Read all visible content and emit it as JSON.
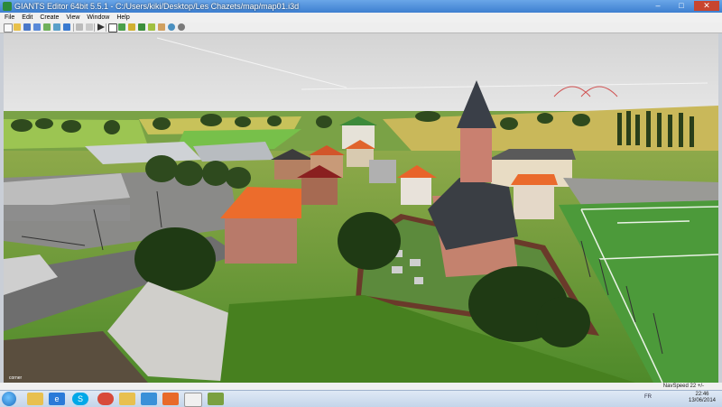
{
  "window": {
    "title": "GIANTS Editor 64bit 5.5.1 - C:/Users/kiki/Desktop/Les Chazets/map/map01.i3d",
    "minimize": "–",
    "maximize": "□",
    "close": "✕"
  },
  "menu": {
    "items": [
      "File",
      "Edit",
      "Create",
      "View",
      "Window",
      "Help"
    ]
  },
  "toolbar": {
    "icons": [
      "new-icon",
      "open-icon",
      "save-icon",
      "save-as-icon",
      "import-icon",
      "export-icon",
      "undo-icon",
      "redo-icon",
      "cut-icon",
      "copy-icon",
      "paste-icon",
      "play-icon",
      "select-icon",
      "move-icon",
      "rotate-icon",
      "scale-icon",
      "terrain-icon",
      "paint-icon",
      "globe-icon",
      "settings-icon"
    ]
  },
  "viewport": {
    "corner_label": "corner"
  },
  "statusbar": {
    "navspeed": "NavSpeed 22 +/-"
  },
  "taskbar": {
    "apps": [
      "start",
      "explorer",
      "internet-explorer",
      "chrome",
      "file-manager",
      "photos",
      "skype",
      "firefox",
      "paint",
      "giants-editor"
    ],
    "tray_lang": "FR",
    "time": "22:46",
    "date": "13/06/2014"
  },
  "colors": {
    "title_blue": "#3d7fd0",
    "grass": "#4f8a2a",
    "roof_orange": "#e8632a",
    "sky": "#dcdcdc"
  }
}
